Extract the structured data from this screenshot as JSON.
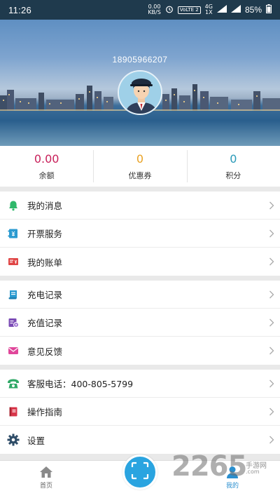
{
  "status_bar": {
    "time": "11:26",
    "speed_value": "0.00",
    "speed_unit": "KB/S",
    "volte": "VoLTE 2",
    "network": "4G",
    "network_sub": "1X",
    "battery": "85%"
  },
  "profile": {
    "phone": "18905966207"
  },
  "stats": [
    {
      "value": "0.00",
      "label": "余额",
      "color": "#c8205a"
    },
    {
      "value": "0",
      "label": "优惠券",
      "color": "#e9a224"
    },
    {
      "value": "0",
      "label": "积分",
      "color": "#2a9ab8"
    }
  ],
  "menu": {
    "group1": [
      {
        "label": "我的消息",
        "icon": "bell-icon",
        "color": "#2fb86a"
      },
      {
        "label": "开票服务",
        "icon": "invoice-icon",
        "color": "#2a9ad0"
      },
      {
        "label": "我的账单",
        "icon": "bill-icon",
        "color": "#e04646"
      }
    ],
    "group2": [
      {
        "label": "充电记录",
        "icon": "charging-record-icon",
        "color": "#2a9ad0"
      },
      {
        "label": "充值记录",
        "icon": "recharge-record-icon",
        "color": "#7b4bb5"
      },
      {
        "label": "意见反馈",
        "icon": "feedback-icon",
        "color": "#e0469a"
      }
    ],
    "group3": [
      {
        "label": "客服电话：400-805-5799",
        "icon": "phone-icon",
        "color": "#2fa866"
      },
      {
        "label": "操作指南",
        "icon": "guide-book-icon",
        "color": "#d8354a"
      },
      {
        "label": "设置",
        "icon": "gear-icon",
        "color": "#2f4d68"
      }
    ]
  },
  "tabbar": {
    "home_label": "首页",
    "mine_label": "我的",
    "active_color": "#2a8fcf"
  },
  "watermark": {
    "number": "2265",
    "site": "手游网",
    "url": ".com"
  }
}
